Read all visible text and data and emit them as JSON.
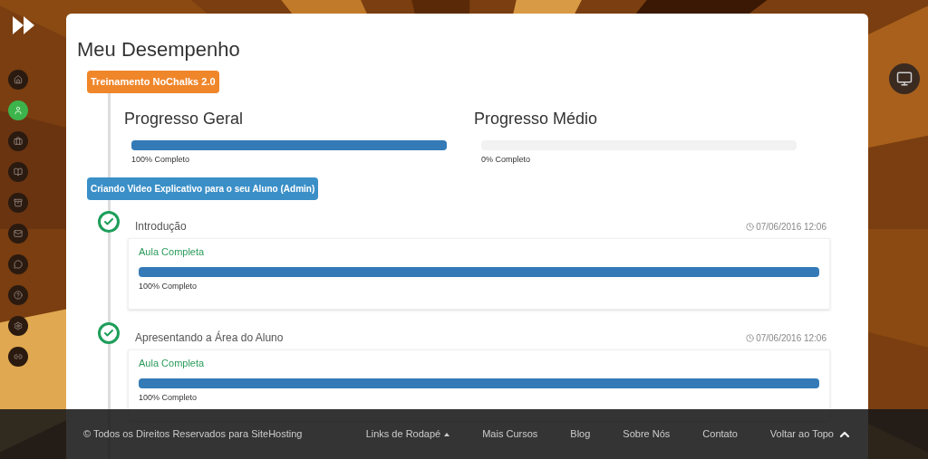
{
  "sidebar": {
    "items": [
      {
        "kind": "home",
        "selected": false
      },
      {
        "kind": "user",
        "selected": true
      },
      {
        "kind": "briefcase",
        "selected": false
      },
      {
        "kind": "book",
        "selected": false
      },
      {
        "kind": "archive",
        "selected": false
      },
      {
        "kind": "mail",
        "selected": false
      },
      {
        "kind": "chat",
        "selected": false
      },
      {
        "kind": "help",
        "selected": false
      },
      {
        "kind": "settings",
        "selected": false
      },
      {
        "kind": "link",
        "selected": false
      }
    ]
  },
  "page_title": "Meu Desempenho",
  "course_badge": "Treinamento NoChalks 2.0",
  "progress": [
    {
      "title": "Progresso Geral",
      "level": 1,
      "caption": "100% Completo"
    },
    {
      "title": "Progresso Médio",
      "level": 0,
      "caption": "0% Completo"
    }
  ],
  "module_badge": "Criando Video Explicativo para o seu Aluno (Admin)",
  "lessons": [
    {
      "title": "Introdução",
      "date": "07/06/2016 12:06",
      "status": "Aula Completa",
      "level": 1,
      "caption": "100% Completo",
      "completed": true
    },
    {
      "title": "Apresentando a Área do Aluno",
      "date": "07/06/2016 12:06",
      "status": "Aula Completa",
      "level": 1,
      "caption": "100% Completo",
      "completed": true
    }
  ],
  "footer": {
    "copyright": "© Todos os Direitos Reservados para SiteHosting",
    "links": [
      {
        "label": "Links de Rodapé",
        "kind": "dropdown"
      },
      {
        "label": "Mais Cursos",
        "kind": "link"
      },
      {
        "label": "Blog",
        "kind": "link"
      },
      {
        "label": "Sobre Nós",
        "kind": "link"
      },
      {
        "label": "Contato",
        "kind": "link"
      },
      {
        "label": "Voltar ao Topo",
        "kind": "top"
      }
    ]
  }
}
